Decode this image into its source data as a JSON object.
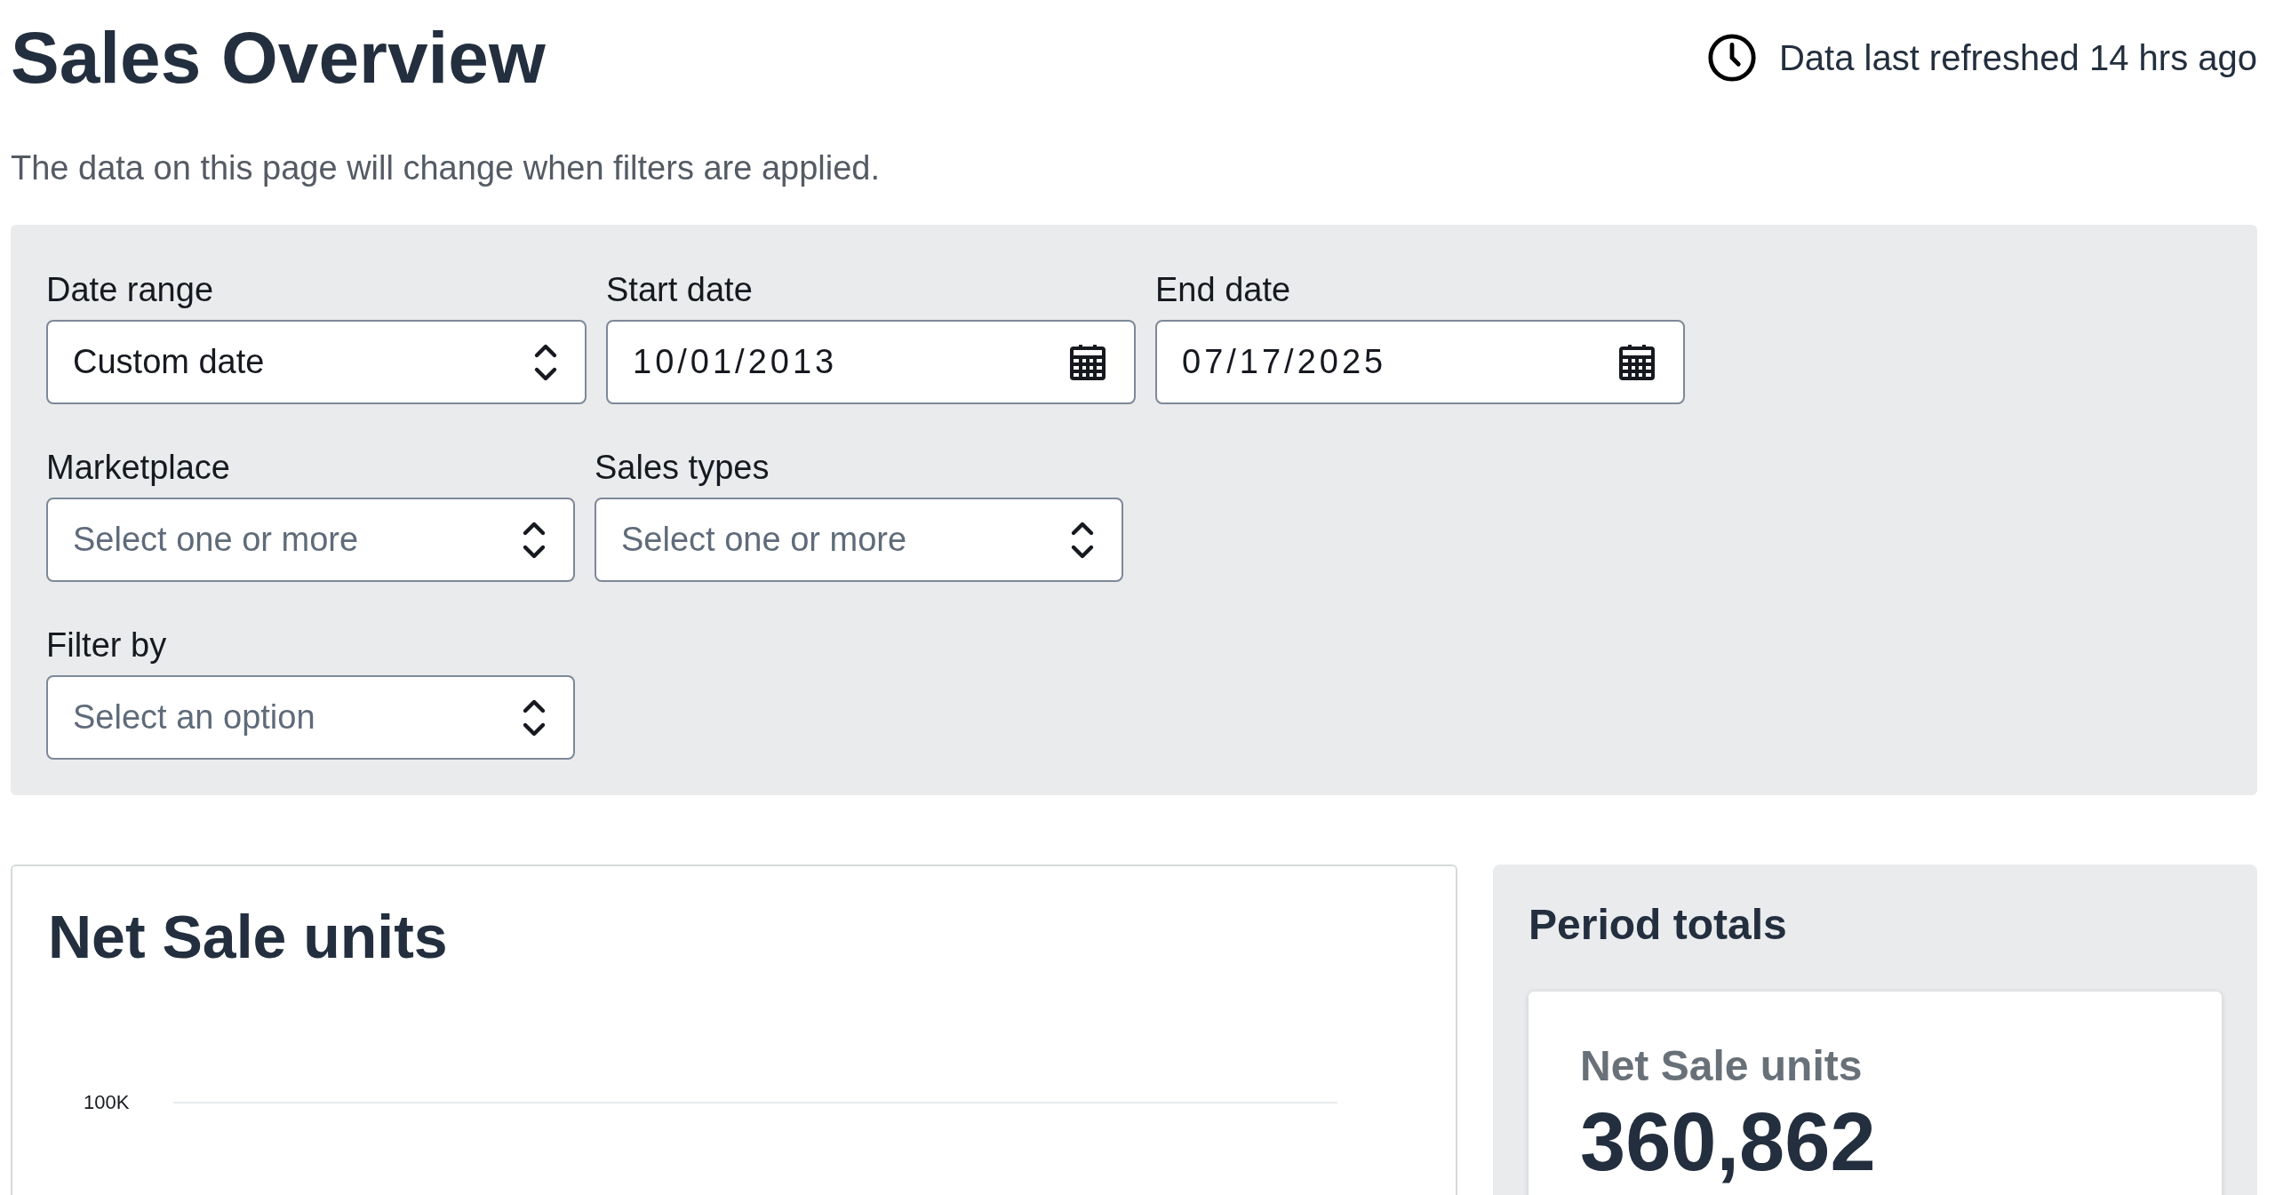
{
  "header": {
    "title": "Sales Overview",
    "refreshed": "Data last refreshed 14 hrs ago",
    "subtitle": "The data on this page will change when filters are applied."
  },
  "filters": [
    [
      {
        "label": "Date range",
        "kind": "select",
        "value": "Custom date"
      },
      {
        "label": "Start date",
        "kind": "date",
        "value": "10/01/2013"
      },
      {
        "label": "End date",
        "kind": "date",
        "value": "07/17/2025"
      }
    ],
    [
      {
        "label": "Marketplace",
        "kind": "select",
        "placeholder": "Select one or more"
      },
      {
        "label": "Sales types",
        "kind": "select",
        "placeholder": "Select one or more"
      }
    ],
    [
      {
        "label": "Filter by",
        "kind": "select",
        "placeholder": "Select an option"
      }
    ]
  ],
  "chart_card": {
    "title": "Net Sale units",
    "y_tick_labels": [
      "100K"
    ]
  },
  "period_totals": {
    "title": "Period totals",
    "metric": {
      "label": "Net Sale units",
      "value": "360,862"
    }
  }
}
